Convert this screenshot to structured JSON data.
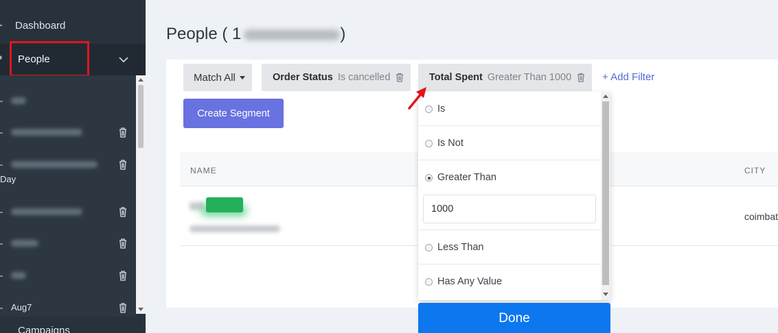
{
  "sidebar": {
    "dashboard_label": "Dashboard",
    "people_label": "People",
    "day_fragment": "Day",
    "aug_item": "Aug7",
    "campaigns_label": "Campaigns"
  },
  "page": {
    "title_prefix": "People ( 1",
    "title_suffix": ")"
  },
  "filters": {
    "match_label": "Match All",
    "chip1": {
      "key": "Order Status",
      "value": "Is cancelled"
    },
    "chip2": {
      "key": "Total Spent",
      "value": "Greater Than 1000"
    },
    "add_filter": "+ Add Filter",
    "create_segment": "Create Segment"
  },
  "table": {
    "col_name": "NAME",
    "col_city": "CITY",
    "row_city": "coimbat"
  },
  "dropdown": {
    "options": [
      {
        "label": "Is",
        "selected": false
      },
      {
        "label": "Is Not",
        "selected": false
      },
      {
        "label": "Greater Than",
        "selected": true
      },
      {
        "label": "Less Than",
        "selected": false
      },
      {
        "label": "Has Any Value",
        "selected": false
      }
    ],
    "value": "1000",
    "done_label": "Done"
  },
  "colors": {
    "sidebar_bg": "#27323c",
    "highlight_box": "#e3151a",
    "create_button": "#6872e0",
    "done_button": "#0d77f0",
    "badge_green": "#22b15a",
    "link": "#4f6ad8"
  }
}
